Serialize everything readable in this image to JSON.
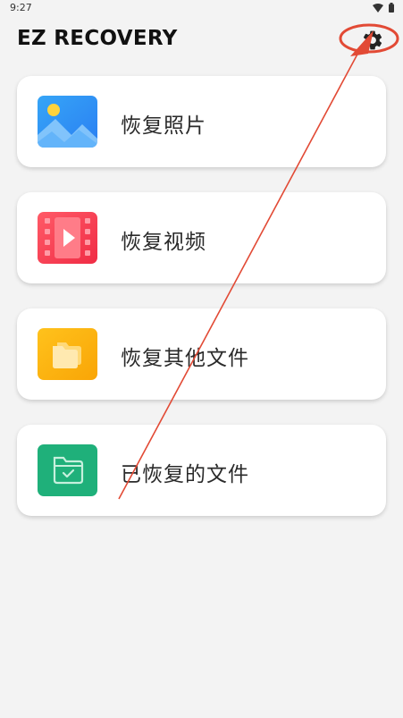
{
  "status_bar": {
    "time": "9:27"
  },
  "app": {
    "title": "EZ RECOVERY"
  },
  "cards": [
    {
      "label": "恢复照片",
      "icon": "photo-icon",
      "color": "#2e8df3"
    },
    {
      "label": "恢复视频",
      "icon": "video-icon",
      "color": "#f6384f"
    },
    {
      "label": "恢复其他文件",
      "icon": "folder-icon",
      "color": "#fbb40a"
    },
    {
      "label": "已恢复的文件",
      "icon": "recovered-folder-icon",
      "color": "#1fb07a"
    }
  ],
  "annotation_color": "#e24a35"
}
